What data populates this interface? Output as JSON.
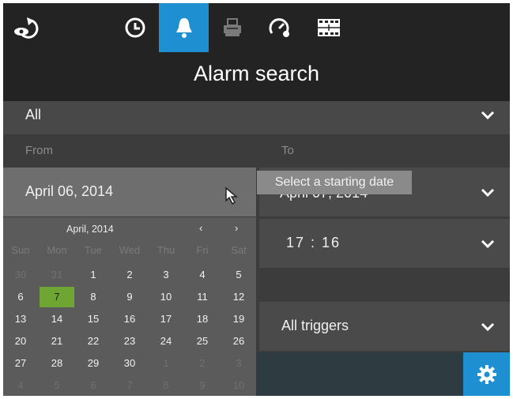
{
  "header": {
    "title": "Alarm search",
    "active_color": "#1e8fd1",
    "icons": [
      "back-eye-icon",
      "clock-icon",
      "bell-icon",
      "printer-icon",
      "speedometer-icon",
      "film-strip-icon"
    ]
  },
  "filters": {
    "event_type": "All",
    "from_label": "From",
    "to_label": "To",
    "from_date": "April 06, 2014",
    "to_date": "April 07, 2014",
    "to_time": "17 : 16",
    "trigger": "All triggers"
  },
  "tooltip": "Select a starting date",
  "calendar": {
    "month_label": "April, 2014",
    "prev": "‹",
    "next": "›",
    "weekdays": [
      "Sun",
      "Mon",
      "Tue",
      "Wed",
      "Thu",
      "Fri",
      "Sat"
    ],
    "weeks": [
      [
        "30",
        "31",
        "1",
        "2",
        "3",
        "4",
        "5"
      ],
      [
        "6",
        "7",
        "8",
        "9",
        "10",
        "11",
        "12"
      ],
      [
        "13",
        "14",
        "15",
        "16",
        "17",
        "18",
        "19"
      ],
      [
        "20",
        "21",
        "22",
        "23",
        "24",
        "25",
        "26"
      ],
      [
        "27",
        "28",
        "29",
        "30",
        "1",
        "2",
        "3"
      ],
      [
        "4",
        "5",
        "6",
        "7",
        "8",
        "9",
        "10"
      ]
    ],
    "selected_day": "7",
    "selected_color": "#6ea533"
  }
}
